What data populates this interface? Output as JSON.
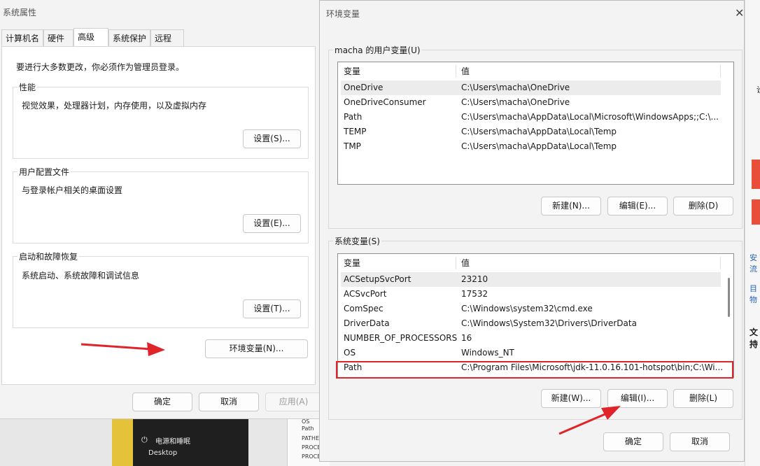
{
  "background": {
    "dark_panel_items": [
      "",
      "电源和睡眠",
      "Desktop"
    ],
    "paper_items": [
      "OS",
      "Path",
      "PATHE",
      "PROCE",
      "PROCE"
    ],
    "right_edge_texts": [
      "设",
      "安流",
      "目物",
      "文持"
    ]
  },
  "system_properties": {
    "title": "系统属性",
    "tabs": [
      "计算机名",
      "硬件",
      "高级",
      "系统保护",
      "远程"
    ],
    "active_tab": "高级",
    "admin_note": "要进行大多数更改，你必须作为管理员登录。",
    "performance": {
      "legend": "性能",
      "description": "视觉效果，处理器计划，内存使用，以及虚拟内存",
      "button": "设置(S)..."
    },
    "user_profiles": {
      "legend": "用户配置文件",
      "description": "与登录帐户相关的桌面设置",
      "button": "设置(E)..."
    },
    "startup_recovery": {
      "legend": "启动和故障恢复",
      "description": "系统启动、系统故障和调试信息",
      "button": "设置(T)..."
    },
    "env_button": "环境变量(N)...",
    "ok": "确定",
    "cancel": "取消",
    "apply": "应用(A)"
  },
  "env_vars": {
    "title": "环境变量",
    "user_section": "macha 的用户变量(U)",
    "user_headers": [
      "变量",
      "值"
    ],
    "user_rows": [
      {
        "name": "OneDrive",
        "value": "C:\\Users\\macha\\OneDrive"
      },
      {
        "name": "OneDriveConsumer",
        "value": "C:\\Users\\macha\\OneDrive"
      },
      {
        "name": "Path",
        "value": "C:\\Users\\macha\\AppData\\Local\\Microsoft\\WindowsApps;;C:\\..."
      },
      {
        "name": "TEMP",
        "value": "C:\\Users\\macha\\AppData\\Local\\Temp"
      },
      {
        "name": "TMP",
        "value": "C:\\Users\\macha\\AppData\\Local\\Temp"
      }
    ],
    "user_buttons": {
      "new": "新建(N)...",
      "edit": "编辑(E)...",
      "delete": "删除(D)"
    },
    "sys_section": "系统变量(S)",
    "sys_headers": [
      "变量",
      "值"
    ],
    "sys_rows": [
      {
        "name": "ACSetupSvcPort",
        "value": "23210"
      },
      {
        "name": "ACSvcPort",
        "value": "17532"
      },
      {
        "name": "ComSpec",
        "value": "C:\\Windows\\system32\\cmd.exe"
      },
      {
        "name": "DriverData",
        "value": "C:\\Windows\\System32\\Drivers\\DriverData"
      },
      {
        "name": "NUMBER_OF_PROCESSORS",
        "value": "16"
      },
      {
        "name": "OS",
        "value": "Windows_NT"
      },
      {
        "name": "Path",
        "value": "C:\\Program Files\\Microsoft\\jdk-11.0.16.101-hotspot\\bin;C:\\Wi..."
      }
    ],
    "sys_buttons": {
      "new": "新建(W)...",
      "edit": "编辑(I)...",
      "delete": "删除(L)"
    },
    "ok": "确定",
    "cancel": "取消"
  },
  "colors": {
    "annotation_red": "#e0252a"
  }
}
